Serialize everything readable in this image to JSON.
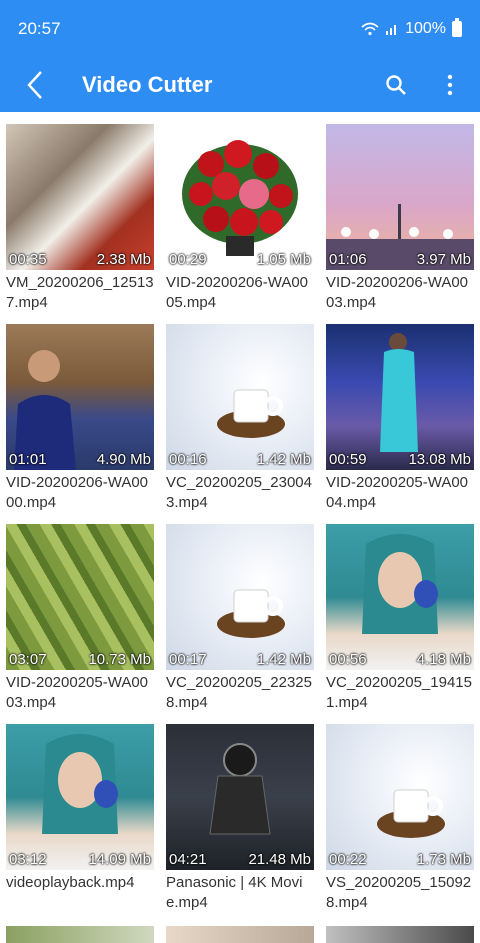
{
  "status": {
    "time": "20:57",
    "battery": "100%"
  },
  "appbar": {
    "title": "Video Cutter"
  },
  "videos": [
    {
      "duration": "00:35",
      "size": "2.38 Mb",
      "name": "VM_20200206_125137.mp4"
    },
    {
      "duration": "00:29",
      "size": "1.05 Mb",
      "name": "VID-20200206-WA0005.mp4"
    },
    {
      "duration": "01:06",
      "size": "3.97 Mb",
      "name": "VID-20200206-WA0003.mp4"
    },
    {
      "duration": "01:01",
      "size": "4.90 Mb",
      "name": "VID-20200206-WA0000.mp4"
    },
    {
      "duration": "00:16",
      "size": "1.42 Mb",
      "name": "VC_20200205_230043.mp4"
    },
    {
      "duration": "00:59",
      "size": "13.08 Mb",
      "name": "VID-20200205-WA0004.mp4"
    },
    {
      "duration": "03:07",
      "size": "10.73 Mb",
      "name": "VID-20200205-WA0003.mp4"
    },
    {
      "duration": "00:17",
      "size": "1.42 Mb",
      "name": "VC_20200205_223258.mp4"
    },
    {
      "duration": "00:56",
      "size": "4.18 Mb",
      "name": "VC_20200205_194151.mp4"
    },
    {
      "duration": "03:12",
      "size": "14.09 Mb",
      "name": "videoplayback.mp4"
    },
    {
      "duration": "04:21",
      "size": "21.48 Mb",
      "name": "Panasonic | 4K Movie.mp4"
    },
    {
      "duration": "00:22",
      "size": "1.73 Mb",
      "name": "VS_20200205_150928.mp4"
    }
  ],
  "colors": {
    "appbar": "#2e8df2",
    "text": "#333333"
  }
}
